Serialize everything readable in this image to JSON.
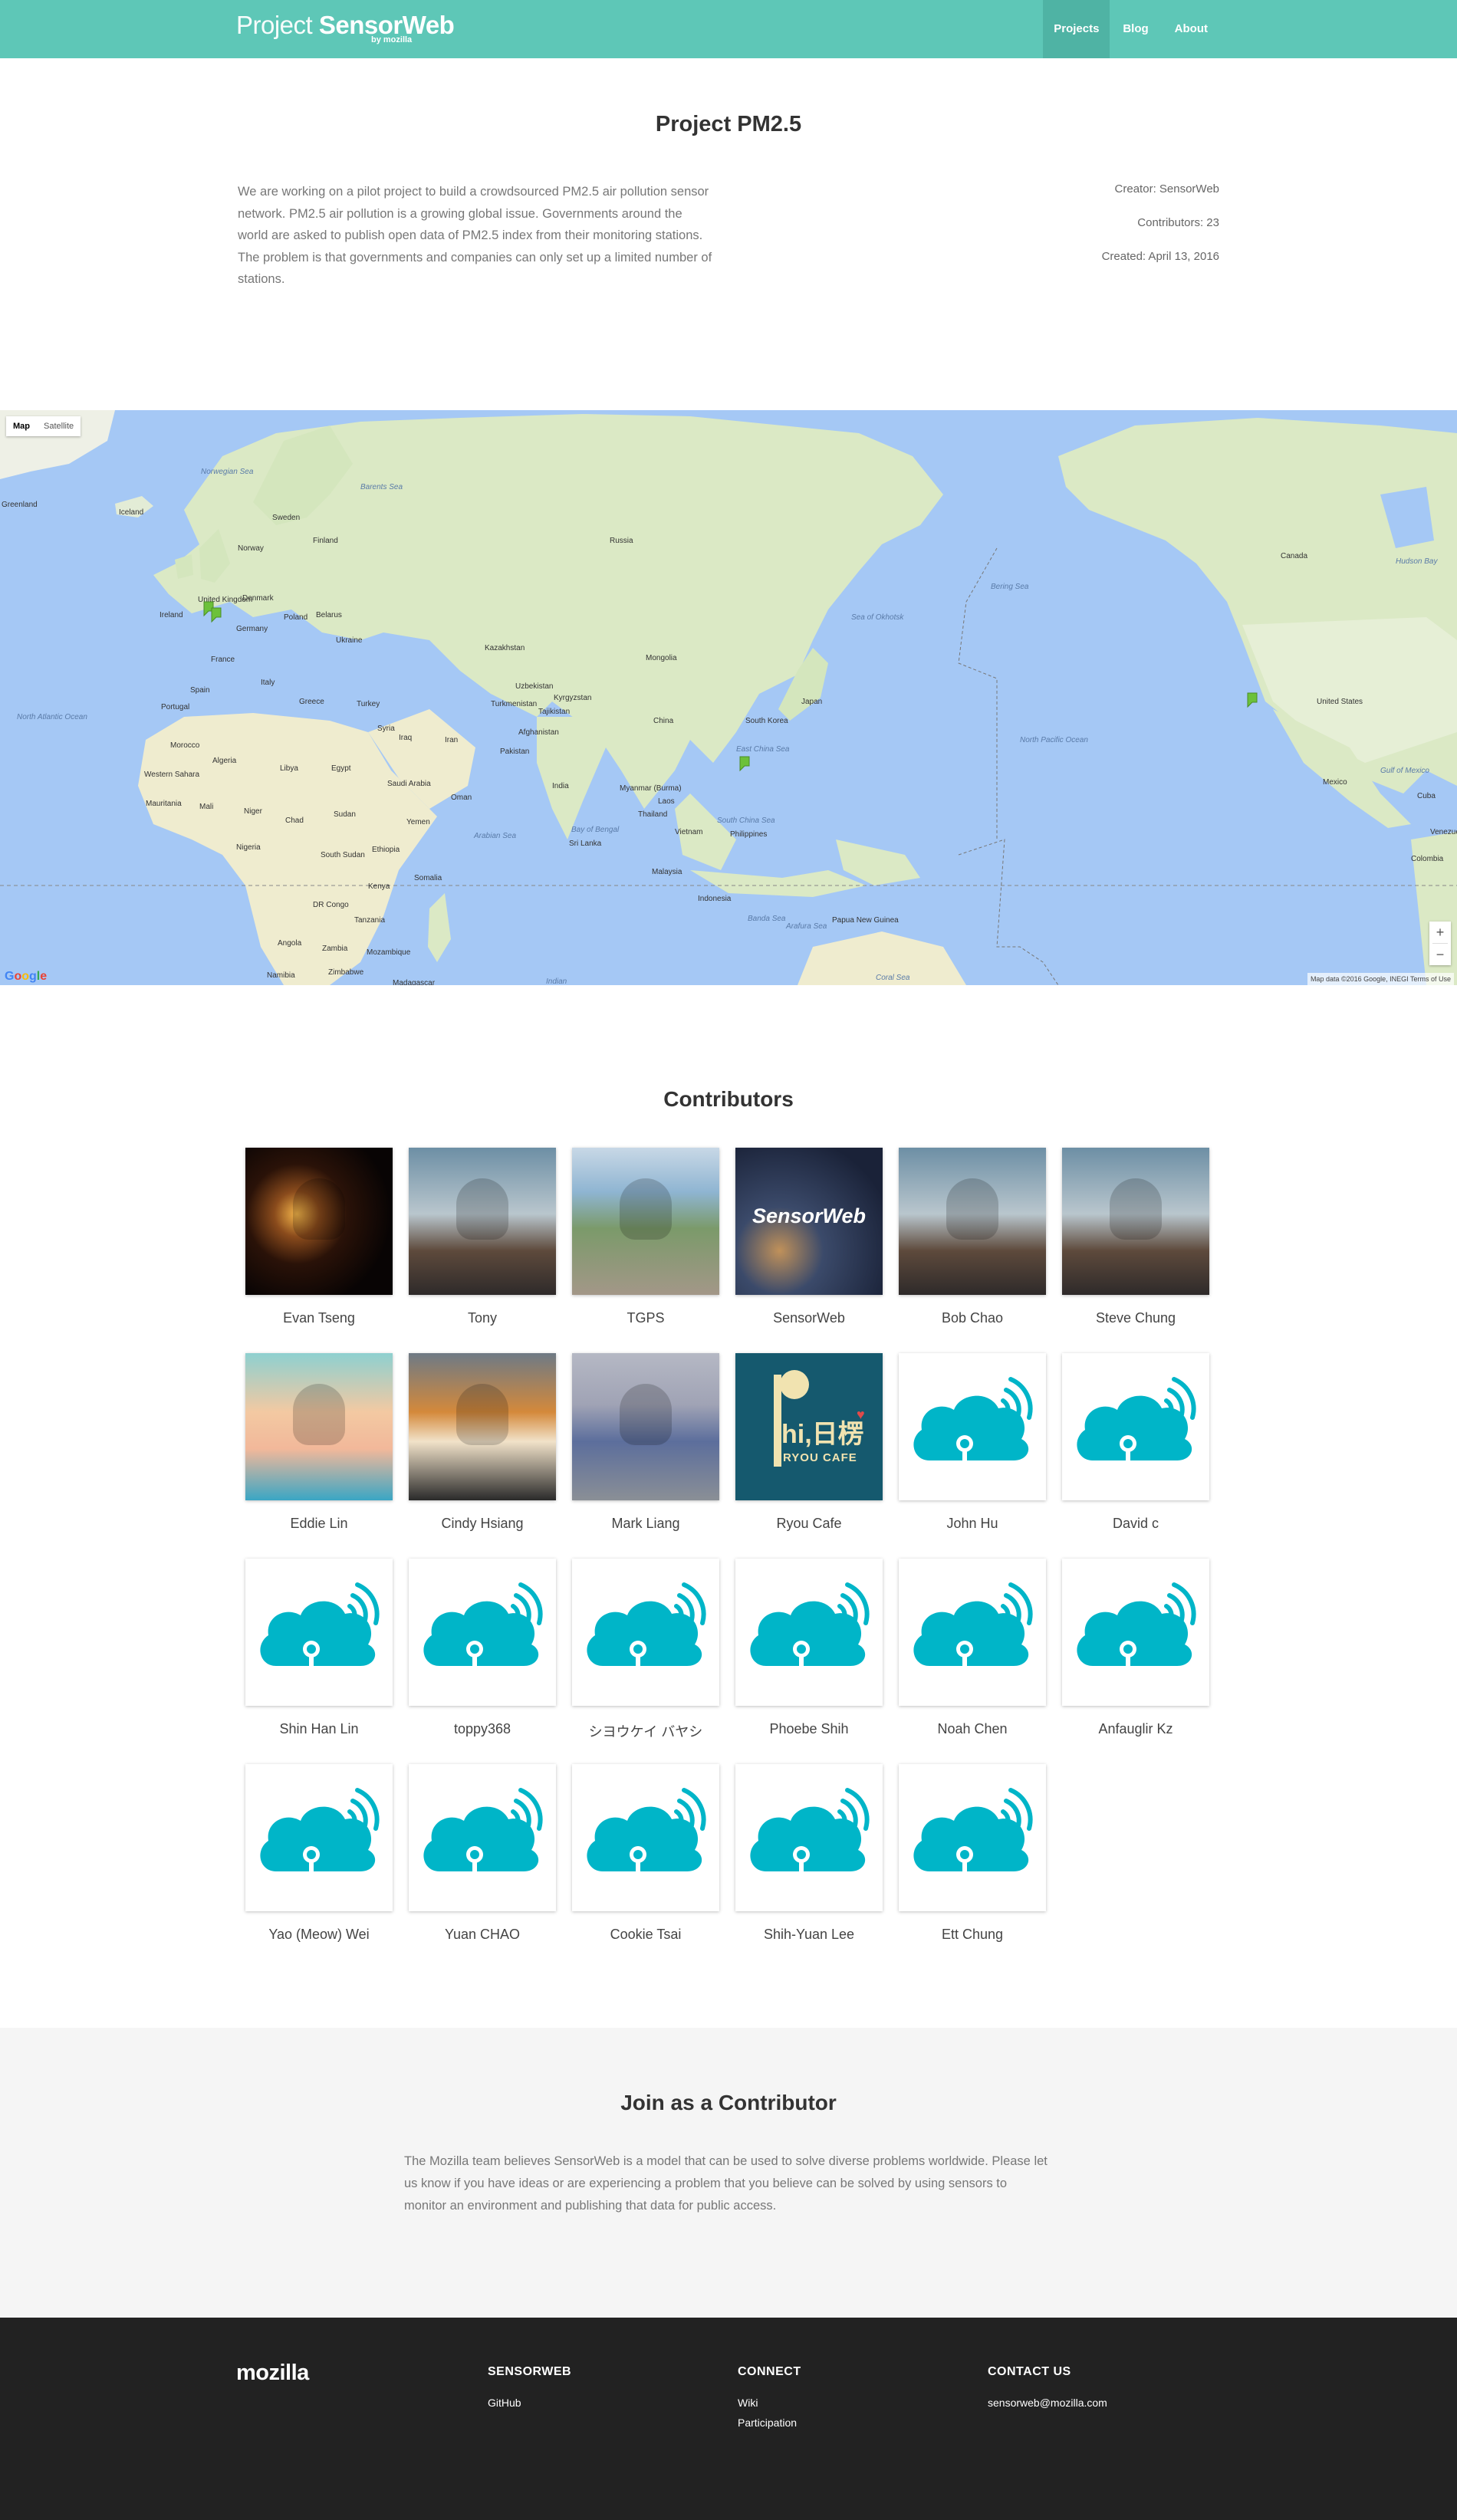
{
  "nav": {
    "brand_light": "Project",
    "brand_bold": "SensorWeb",
    "brand_sub": "by mozilla",
    "links": [
      {
        "label": "Projects",
        "active": true
      },
      {
        "label": "Blog",
        "active": false
      },
      {
        "label": "About",
        "active": false
      }
    ]
  },
  "project": {
    "title": "Project PM2.5",
    "description": "We are working on a pilot project to build a crowdsourced PM2.5 air pollution sensor network. PM2.5 air pollution is a growing global issue. Governments around the world are asked to publish open data of PM2.5 index from their monitoring stations. The problem is that governments and companies can only set up a limited number of stations.",
    "creator": "Creator: SensorWeb",
    "contributors": "Contributors: 23",
    "created": "Created: April 13, 2016"
  },
  "map": {
    "type_map": "Map",
    "type_satellite": "Satellite",
    "zoom_in": "+",
    "zoom_out": "−",
    "credit": "Map data ©2016 Google, INEGI     Terms of Use",
    "labels": [
      "Norwegian Sea",
      "Iceland",
      "Sweden",
      "Finland",
      "Norway",
      "Russia",
      "Greenland",
      "Barents Sea",
      "Ireland",
      "United Kingdom",
      "Denmark",
      "Poland",
      "Germany",
      "Belarus",
      "Ukraine",
      "France",
      "Kazakhstan",
      "Mongolia",
      "Spain",
      "Portugal",
      "Italy",
      "Greece",
      "Turkey",
      "Uzbekistan",
      "Turkmenistan",
      "Kyrgyzstan",
      "Tajikistan",
      "China",
      "Syria",
      "Iraq",
      "Iran",
      "Afghanistan",
      "Pakistan",
      "South Korea",
      "Japan",
      "North Atlantic Ocean",
      "Morocco",
      "Algeria",
      "Libya",
      "Egypt",
      "Saudi Arabia",
      "India",
      "Oman",
      "Western Sahara",
      "Mauritania",
      "Mali",
      "Niger",
      "Chad",
      "Sudan",
      "Yemen",
      "Arabian Sea",
      "Bay of Bengal",
      "Myanmar (Burma)",
      "Thailand",
      "Vietnam",
      "Philippines",
      "Laos",
      "Ethiopia",
      "Nigeria",
      "South Sudan",
      "Somalia",
      "Kenya",
      "Tanzania",
      "DR Congo",
      "Angola",
      "Zambia",
      "Mozambique",
      "Madagascar",
      "Namibia",
      "Zimbabwe",
      "Malaysia",
      "Indonesia",
      "Papua New Guinea",
      "Banda Sea",
      "Arafura Sea",
      "Coral Sea",
      "South China Sea",
      "East China Sea",
      "Sea of Okhotsk",
      "Bering Sea",
      "North Pacific Ocean",
      "Canada",
      "Hudson Bay",
      "United States",
      "Mexico",
      "Gulf of Mexico",
      "Cuba",
      "Venezuela",
      "Colombia",
      "Sri Lanka",
      "Indian"
    ]
  },
  "contributors_section": {
    "title": "Contributors",
    "people": [
      {
        "name": "Evan Tseng",
        "avatar": "photo-dark"
      },
      {
        "name": "Tony",
        "avatar": "photo-person"
      },
      {
        "name": "TGPS",
        "avatar": "photo-sign"
      },
      {
        "name": "SensorWeb",
        "avatar": "sensorweb-logo"
      },
      {
        "name": "Bob Chao",
        "avatar": "photo-person"
      },
      {
        "name": "Steve Chung",
        "avatar": "photo-person"
      },
      {
        "name": "Eddie Lin",
        "avatar": "illustration"
      },
      {
        "name": "Cindy Hsiang",
        "avatar": "photo-fox"
      },
      {
        "name": "Mark Liang",
        "avatar": "photo-street"
      },
      {
        "name": "Ryou Cafe",
        "avatar": "ryou-cafe-logo"
      },
      {
        "name": "John Hu",
        "avatar": "cloud-sensor-icon"
      },
      {
        "name": "David c",
        "avatar": "cloud-sensor-icon"
      },
      {
        "name": "Shin Han Lin",
        "avatar": "cloud-sensor-icon"
      },
      {
        "name": "toppy368",
        "avatar": "cloud-sensor-icon"
      },
      {
        "name": "シヨウケイ バヤシ",
        "avatar": "cloud-sensor-icon"
      },
      {
        "name": "Phoebe Shih",
        "avatar": "cloud-sensor-icon"
      },
      {
        "name": "Noah Chen",
        "avatar": "cloud-sensor-icon"
      },
      {
        "name": "Anfauglir Kz",
        "avatar": "cloud-sensor-icon"
      },
      {
        "name": "Yao (Meow) Wei",
        "avatar": "cloud-sensor-icon"
      },
      {
        "name": "Yuan CHAO",
        "avatar": "cloud-sensor-icon"
      },
      {
        "name": "Cookie Tsai",
        "avatar": "cloud-sensor-icon"
      },
      {
        "name": "Shih-Yuan Lee",
        "avatar": "cloud-sensor-icon"
      },
      {
        "name": "Ett Chung",
        "avatar": "cloud-sensor-icon"
      }
    ],
    "sensorweb_logo_text": "SensorWeb",
    "ryou_logo_text": "hi,日楞",
    "ryou_logo_sub": "RYOU CAFE"
  },
  "join": {
    "title": "Join as a Contributor",
    "text": "The Mozilla team believes SensorWeb is a model that can be used to solve diverse problems worldwide. Please let us know if you have ideas or are experiencing a problem that you believe can be solved by using sensors to monitor an environment and publishing that data for public access."
  },
  "footer": {
    "logo": "mozilla",
    "columns": [
      {
        "heading": "SENSORWEB",
        "links": [
          "GitHub"
        ]
      },
      {
        "heading": "CONNECT",
        "links": [
          "Wiki",
          "Participation"
        ]
      },
      {
        "heading": "CONTACT US",
        "links": [
          "sensorweb@mozilla.com"
        ]
      }
    ]
  },
  "colors": {
    "nav": "#5ec7b7",
    "nav_active": "#4fb3a4",
    "cloud_icon": "#00b5c8",
    "map_water": "#a5c8f5",
    "map_land": "#d7e8c1",
    "footer": "#222222",
    "join_bg": "#f5f5f5",
    "pin": "#6cc13a"
  }
}
